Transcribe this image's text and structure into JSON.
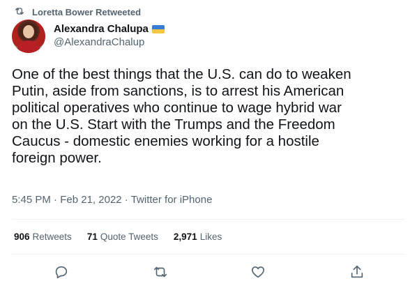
{
  "retweeted_by": "Loretta Bower Retweeted",
  "author": {
    "display_name": "Alexandra Chalupa",
    "handle": "@AlexandraChalup"
  },
  "tweet": {
    "text": "One of the best things that the U.S. can do to weaken\nPutin, aside from sanctions, is to arrest his American\npolitical operatives who continue to wage hybrid war\non the U.S. Start with the Trumps and the Freedom\nCaucus - domestic enemies working for a hostile\nforeign power.",
    "time": "5:45 PM",
    "separator1": "·",
    "date": "Feb 21, 2022",
    "separator2": "·",
    "source": "Twitter for iPhone"
  },
  "stats": {
    "retweets_count": "906",
    "retweets_label": "Retweets",
    "quotes_count": "71",
    "quotes_label": "Quote Tweets",
    "likes_count": "2,971",
    "likes_label": "Likes"
  },
  "icons": {
    "retweet_banner": "retweet-icon",
    "reply": "reply-icon",
    "retweet": "retweet-icon",
    "like": "heart-icon",
    "share": "share-icon",
    "flag": "ukraine-flag-icon"
  },
  "colors": {
    "text": "#0f1419",
    "secondary": "#536471",
    "divider": "#eff3f4",
    "flag_blue": "#3a7bd5",
    "flag_yellow": "#f6c744"
  }
}
